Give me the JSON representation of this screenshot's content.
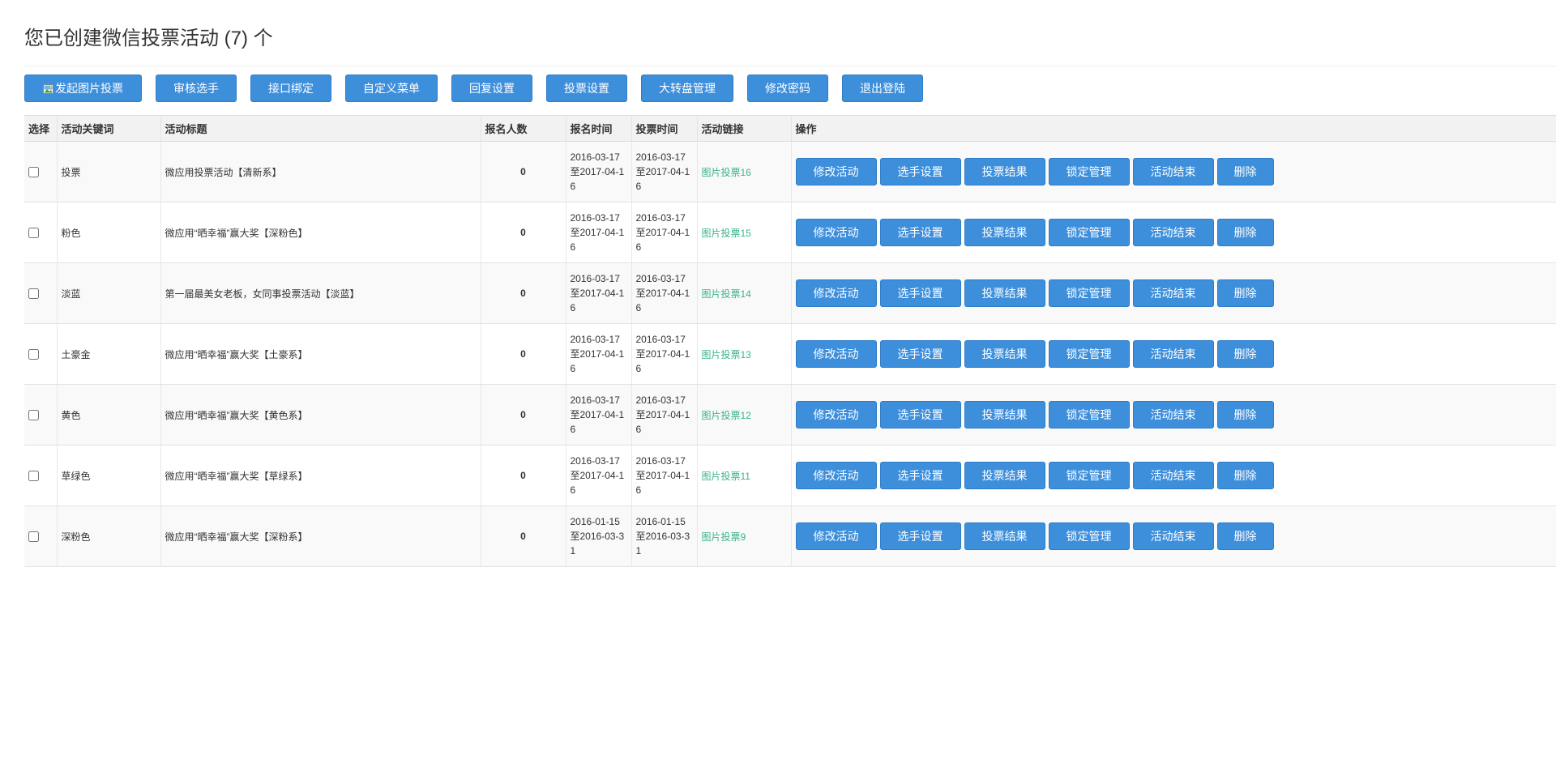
{
  "page": {
    "title": "您已创建微信投票活动 (7) 个"
  },
  "toolbar": {
    "buttons": [
      {
        "label": "发起图片投票",
        "icon": "image-icon"
      },
      {
        "label": "审核选手"
      },
      {
        "label": "接口绑定"
      },
      {
        "label": "自定义菜单"
      },
      {
        "label": "回复设置"
      },
      {
        "label": "投票设置"
      },
      {
        "label": "大转盘管理"
      },
      {
        "label": "修改密码"
      },
      {
        "label": "退出登陆"
      }
    ]
  },
  "table": {
    "headers": {
      "select": "选择",
      "keyword": "活动关键词",
      "title": "活动标题",
      "count": "报名人数",
      "signup_time": "报名时间",
      "vote_time": "投票时间",
      "link": "活动链接",
      "actions": "操作"
    },
    "actions": {
      "edit": "修改活动",
      "players": "选手设置",
      "results": "投票结果",
      "lock": "锁定管理",
      "end": "活动结束",
      "delete": "删除"
    },
    "rows": [
      {
        "keyword": "投票",
        "title": "微应用投票活动【清新系】",
        "count": "0",
        "signup_time": "2016-03-17至2017-04-16",
        "vote_time": "2016-03-17至2017-04-16",
        "link": "图片投票16"
      },
      {
        "keyword": "粉色",
        "title": "微应用“晒幸福”赢大奖【深粉色】",
        "count": "0",
        "signup_time": "2016-03-17至2017-04-16",
        "vote_time": "2016-03-17至2017-04-16",
        "link": "图片投票15"
      },
      {
        "keyword": "淡蓝",
        "title": "第一届最美女老板，女同事投票活动【淡蓝】",
        "count": "0",
        "signup_time": "2016-03-17至2017-04-16",
        "vote_time": "2016-03-17至2017-04-16",
        "link": "图片投票14"
      },
      {
        "keyword": "土豪金",
        "title": "微应用“晒幸福”赢大奖【土豪系】",
        "count": "0",
        "signup_time": "2016-03-17至2017-04-16",
        "vote_time": "2016-03-17至2017-04-16",
        "link": "图片投票13"
      },
      {
        "keyword": "黄色",
        "title": "微应用“晒幸福”赢大奖【黄色系】",
        "count": "0",
        "signup_time": "2016-03-17至2017-04-16",
        "vote_time": "2016-03-17至2017-04-16",
        "link": "图片投票12"
      },
      {
        "keyword": "草绿色",
        "title": "微应用“晒幸福”赢大奖【草绿系】",
        "count": "0",
        "signup_time": "2016-03-17至2017-04-16",
        "vote_time": "2016-03-17至2017-04-16",
        "link": "图片投票11"
      },
      {
        "keyword": "深粉色",
        "title": "微应用“晒幸福”赢大奖【深粉系】",
        "count": "0",
        "signup_time": "2016-01-15至2016-03-31",
        "vote_time": "2016-01-15至2016-03-31",
        "link": "图片投票9"
      }
    ]
  },
  "colors": {
    "button_blue": "#3d8fdc",
    "link_green": "#39b38a"
  }
}
